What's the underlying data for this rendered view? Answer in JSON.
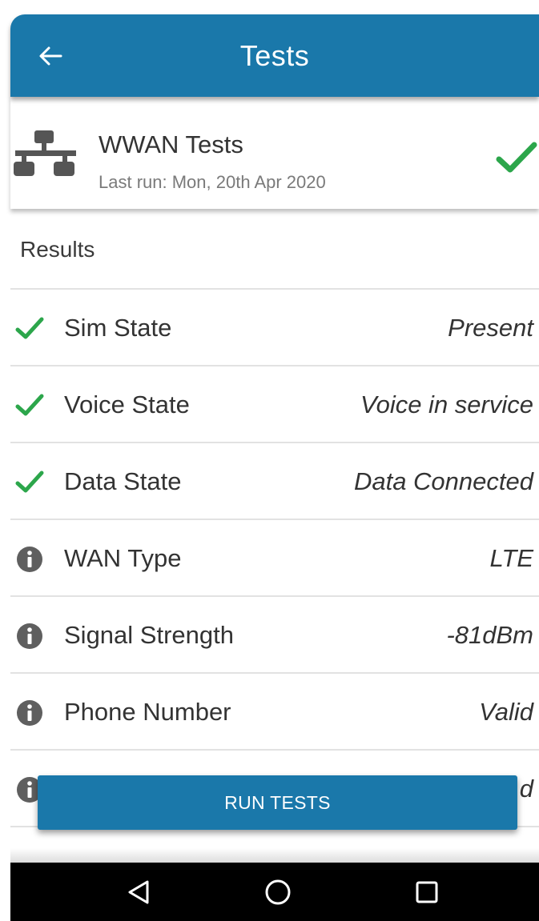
{
  "appbar": {
    "title": "Tests",
    "back_icon": "arrow-left-icon",
    "color": "#1a78aa"
  },
  "test_card": {
    "icon": "network-icon",
    "title": "WWAN Tests",
    "last_run": "Last run: Mon, 20th Apr 2020",
    "status_icon": "check-icon"
  },
  "results": {
    "heading": "Results",
    "rows": [
      {
        "icon": "check-icon",
        "label": "Sim State",
        "value": "Present"
      },
      {
        "icon": "check-icon",
        "label": "Voice State",
        "value": "Voice in service"
      },
      {
        "icon": "check-icon",
        "label": "Data State",
        "value": "Data Connected"
      },
      {
        "icon": "info-icon",
        "label": "WAN Type",
        "value": "LTE"
      },
      {
        "icon": "info-icon",
        "label": "Signal Strength",
        "value": "-81dBm"
      },
      {
        "icon": "info-icon",
        "label": "Phone Number",
        "value": "Valid"
      },
      {
        "icon": "info-icon",
        "label": "",
        "value": "d"
      }
    ]
  },
  "run_button": {
    "label": "RUN TESTS"
  },
  "nav": {
    "back_icon": "nav-back-icon",
    "home_icon": "nav-home-icon",
    "recents_icon": "nav-recents-icon"
  },
  "colors": {
    "primary": "#1a78aa",
    "success": "#2ca64b",
    "info": "#5f5f5f"
  }
}
